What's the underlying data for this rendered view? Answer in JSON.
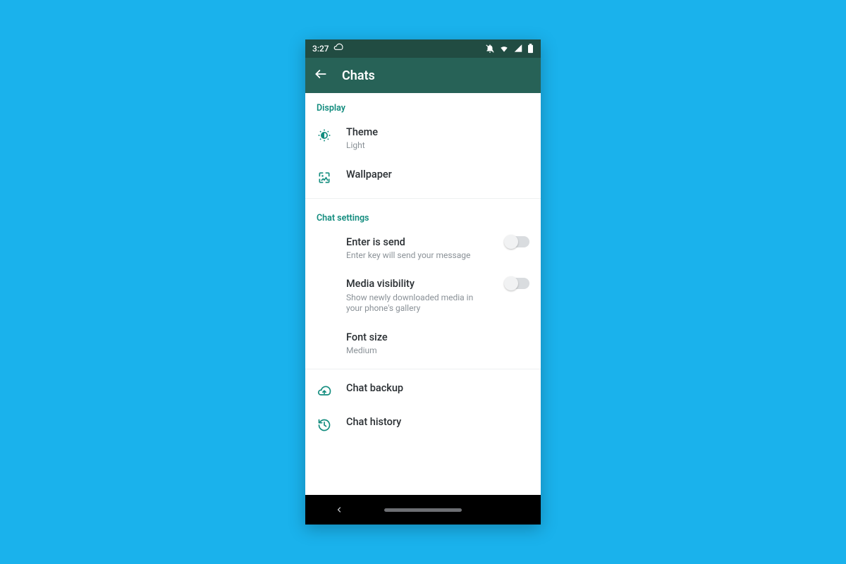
{
  "statusBar": {
    "time": "3:27"
  },
  "appBar": {
    "title": "Chats"
  },
  "sections": {
    "display": {
      "header": "Display",
      "theme": {
        "title": "Theme",
        "value": "Light"
      },
      "wallpaper": {
        "title": "Wallpaper"
      }
    },
    "chatSettings": {
      "header": "Chat settings",
      "enterIsSend": {
        "title": "Enter is send",
        "sub": "Enter key will send your message",
        "on": false
      },
      "mediaVisibility": {
        "title": "Media visibility",
        "sub": "Show newly downloaded media in your phone's gallery",
        "on": false
      },
      "fontSize": {
        "title": "Font size",
        "value": "Medium"
      }
    },
    "other": {
      "chatBackup": {
        "title": "Chat backup"
      },
      "chatHistory": {
        "title": "Chat history"
      }
    }
  },
  "colors": {
    "accent": "#128c7e",
    "appBar": "#276257",
    "statusBar": "#214c42",
    "pageBg": "#1ab2ec"
  }
}
